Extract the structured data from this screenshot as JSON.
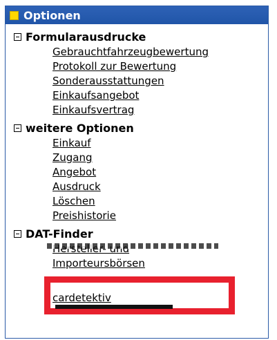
{
  "panel": {
    "title": "Optionen"
  },
  "sections": [
    {
      "title": "Formularausdrucke",
      "items": [
        "Gebrauchtfahrzeugbewertung",
        "Protokoll zur Bewertung",
        "Sonderausstattungen",
        "Einkaufsangebot",
        "Einkaufsvertrag"
      ]
    },
    {
      "title": "weitere Optionen",
      "items": [
        "Einkauf",
        "Zugang",
        "Angebot",
        "Ausdruck",
        "Löschen",
        "Preishistorie"
      ]
    },
    {
      "title": "DAT-Finder",
      "items": [
        "Hersteller- und",
        "Importeursbörsen",
        "cardetektiv"
      ]
    }
  ],
  "colors": {
    "header_bg": "#2055a8",
    "accent_yellow": "#ffd800",
    "highlight_red": "#e8212e"
  }
}
